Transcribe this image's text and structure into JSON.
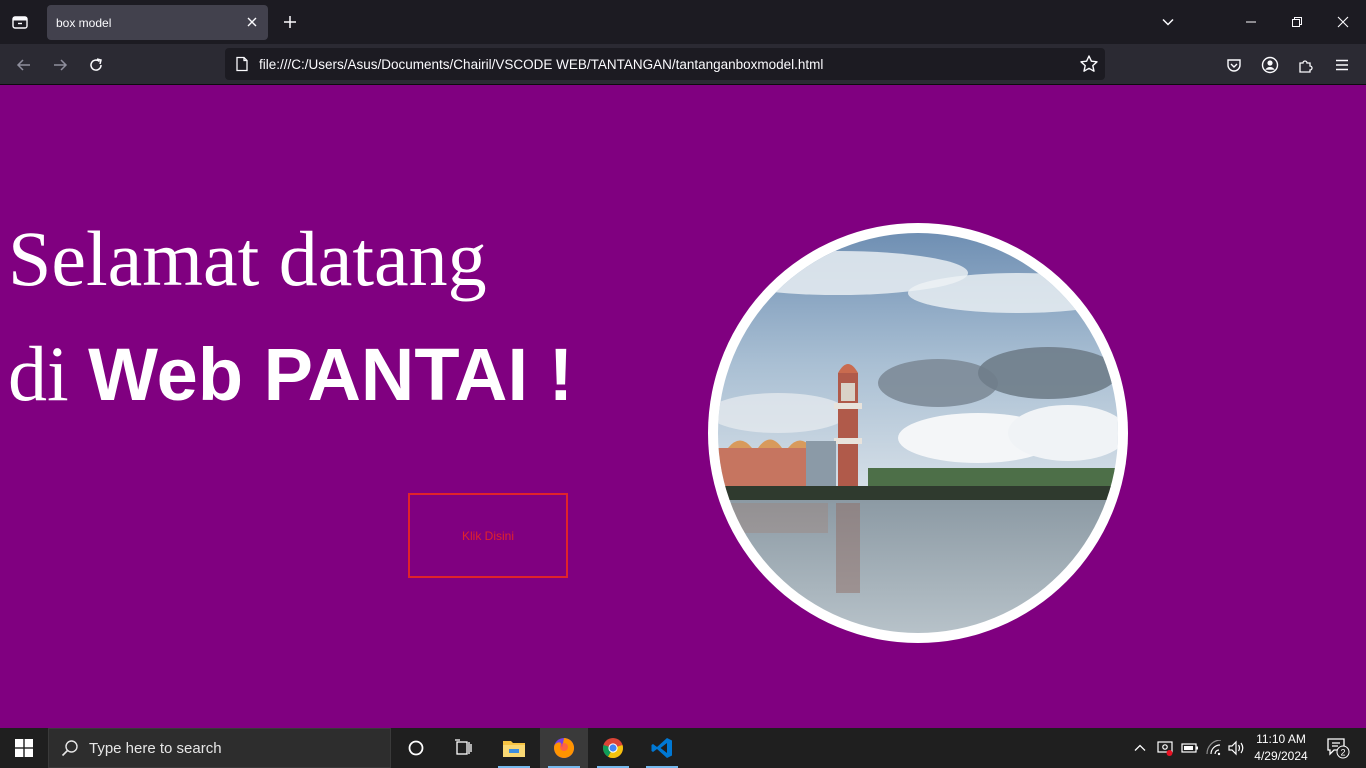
{
  "browser": {
    "tab_title": "box model",
    "url": "file:///C:/Users/Asus/Documents/Chairil/VSCODE WEB/TANTANGAN/tantanganboxmodel.html"
  },
  "page": {
    "heading_line1": "Selamat datang",
    "heading_line2_prefix": "di",
    "heading_line2_bold": "Web PANTAI !",
    "button_label": "Klik Disini",
    "colors": {
      "background": "#800080",
      "heading_text": "#ffffff",
      "button": "#e0232b",
      "image_border": "#ffffff"
    }
  },
  "taskbar": {
    "search_placeholder": "Type here to search",
    "time": "11:10 AM",
    "date": "4/29/2024",
    "notification_count": "2",
    "apps": [
      "task-view",
      "file-explorer",
      "firefox",
      "chrome",
      "vscode"
    ]
  }
}
